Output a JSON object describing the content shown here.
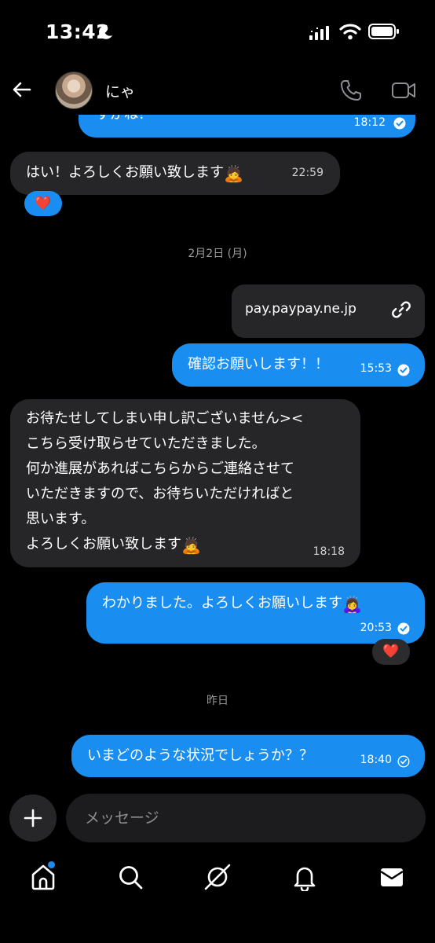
{
  "status_bar": {
    "time": "13:42"
  },
  "header": {
    "contact_name": "にゃ"
  },
  "messages": [
    {
      "side": "sent",
      "text": "すかね？",
      "time": "18:12"
    },
    {
      "side": "recv",
      "text": "はい！よろしくお願い致します",
      "emoji": "🙇",
      "time": "22:59",
      "reaction": "❤️"
    },
    {
      "side": "date",
      "text": "2月2日 (月)"
    },
    {
      "side": "sent",
      "type": "link",
      "text": "pay.paypay.ne.jp"
    },
    {
      "side": "sent",
      "text": "確認お願いします！！",
      "time": "15:53"
    },
    {
      "side": "recv",
      "text": "お待たせしてしまい申し訳ございません><\nこちら受け取らせていただきました。\n何か進展があればこちらからご連絡させて\nいただきますので、お待ちいただければと\n思います。\nよろしくお願い致します",
      "emoji": "🙇",
      "time": "18:18"
    },
    {
      "side": "sent",
      "text": "わかりました。よろしくお願いします",
      "emoji": "🙇‍♀️",
      "time": "20:53",
      "reaction": "❤️"
    },
    {
      "side": "date",
      "text": "昨日"
    },
    {
      "side": "sent",
      "text": "いまどのような状況でしょうか？？",
      "time": "18:40"
    }
  ],
  "composer": {
    "placeholder": "メッセージ"
  },
  "icons": {
    "back": "back-arrow-icon",
    "phone": "phone-icon",
    "video": "video-icon",
    "link": "link-icon",
    "home": "home-icon",
    "search": "search-icon",
    "explore": "explore-icon",
    "notifications": "bell-icon",
    "messages": "inbox-icon"
  },
  "colors": {
    "sent_bubble": "#1a8ef0",
    "received_bubble": "#262628",
    "background": "#000000",
    "heart": "#e8232f"
  }
}
